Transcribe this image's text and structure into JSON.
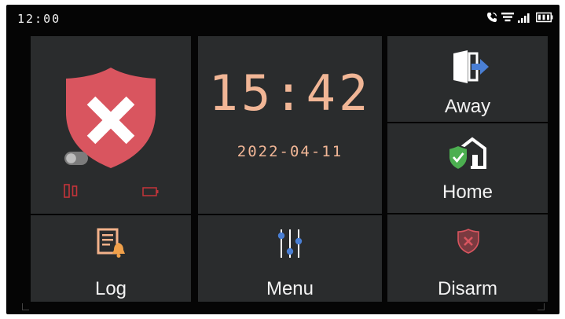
{
  "status_bar": {
    "time": "12:00",
    "icons": [
      "phone-icon",
      "wifi-icon",
      "signal-icon",
      "battery-icon"
    ]
  },
  "clock_tile": {
    "time": "15:42",
    "date": "2022-04-11"
  },
  "status_tile": {
    "icons": [
      "shield-disarmed-icon",
      "toggle-icon",
      "door-sensor-icon",
      "battery-low-icon"
    ]
  },
  "buttons": {
    "away": "Away",
    "home": "Home",
    "disarm": "Disarm",
    "log": "Log",
    "menu": "Menu"
  },
  "colors": {
    "tile_background": "#2a2c2d",
    "shield_red": "#d9555f",
    "alert_red": "#c4343a",
    "clock_digits": "#f1b696",
    "arm_blue": "#4a7fd4",
    "home_green": "#4caf50"
  }
}
